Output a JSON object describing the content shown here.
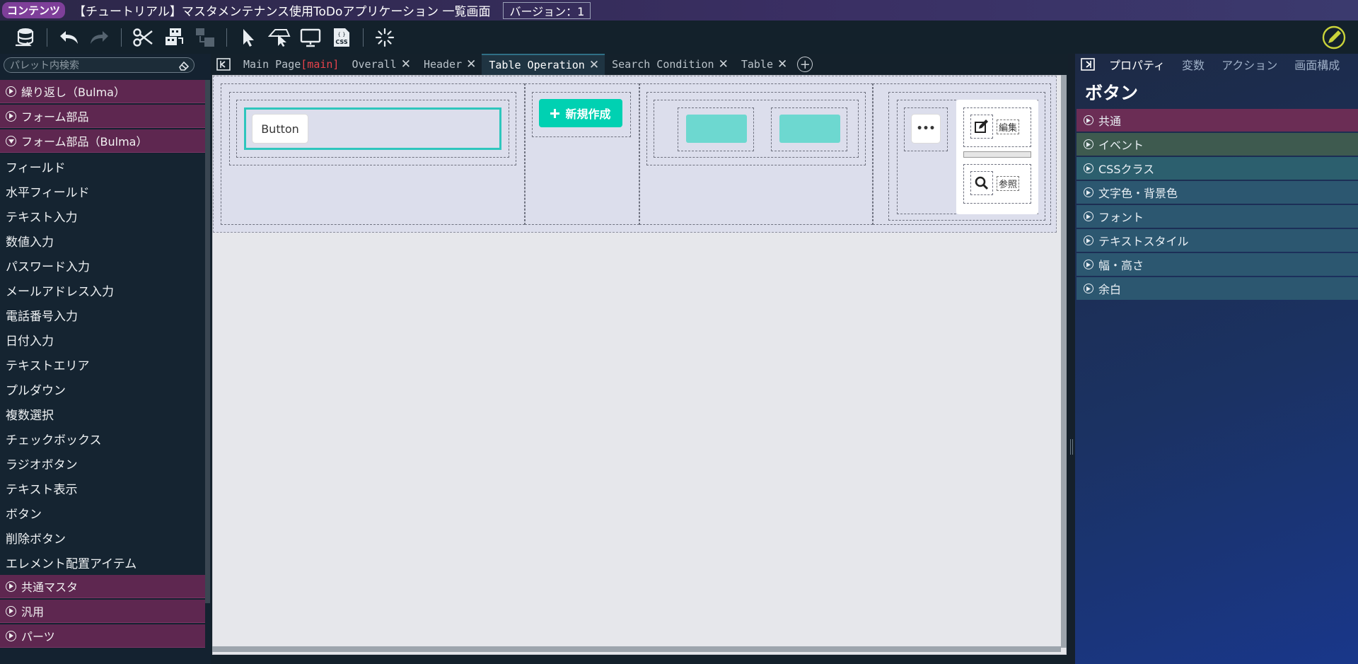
{
  "titlebar": {
    "badge": "コンテンツ",
    "title": "【チュートリアル】マスタメンテナンス使用ToDoアプリケーション 一覧画面",
    "version": "バージョン：1"
  },
  "toolbar": {
    "items": [
      "database-sync-icon",
      "undo-icon",
      "redo-icon",
      "cut-icon",
      "copy-icon",
      "paste-icon",
      "select-cursor-icon",
      "click-element-icon",
      "preview-monitor-icon",
      "css-icon",
      "loading-spinner-icon"
    ],
    "right_icon": "edit-pencil-icon",
    "css_label": "CSS"
  },
  "sidebar": {
    "search_placeholder": "パレット内検索",
    "categories_top": [
      {
        "label": "繰り返し（Bulma）"
      },
      {
        "label": "フォーム部品"
      },
      {
        "label": "フォーム部品（Bulma）"
      }
    ],
    "items": [
      "フィールド",
      "水平フィールド",
      "テキスト入力",
      "数値入力",
      "パスワード入力",
      "メールアドレス入力",
      "電話番号入力",
      "日付入力",
      "テキストエリア",
      "プルダウン",
      "複数選択",
      "チェックボックス",
      "ラジオボタン",
      "テキスト表示",
      "ボタン",
      "削除ボタン",
      "エレメント配置アイテム"
    ],
    "categories_bottom": [
      {
        "label": "共通マスタ"
      },
      {
        "label": "汎用"
      },
      {
        "label": "パーツ"
      }
    ]
  },
  "tabs": {
    "main_page": "Main Page",
    "main_marker": "[main]",
    "list": [
      {
        "label": "Overall"
      },
      {
        "label": "Header"
      },
      {
        "label": "Table Operation"
      },
      {
        "label": "Search Condition"
      },
      {
        "label": "Table"
      }
    ],
    "active": "Table Operation"
  },
  "canvas": {
    "button_label": "Button",
    "new_button_label": "新規作成",
    "more_label": "•••",
    "edit_label": "編集",
    "ref_label": "参照"
  },
  "right_panel": {
    "tabs": [
      "プロパティ",
      "変数",
      "アクション",
      "画面構成"
    ],
    "active_tab": "プロパティ",
    "title": "ボタン",
    "sections": [
      "共通",
      "イベント",
      "CSSクラス",
      "文字色・背景色",
      "フォント",
      "テキストスタイル",
      "幅・高さ",
      "余白"
    ]
  },
  "colors": {
    "accent_teal": "#00d1b2",
    "category_purple": "#5e2750",
    "main_marker": "#e8434b"
  }
}
